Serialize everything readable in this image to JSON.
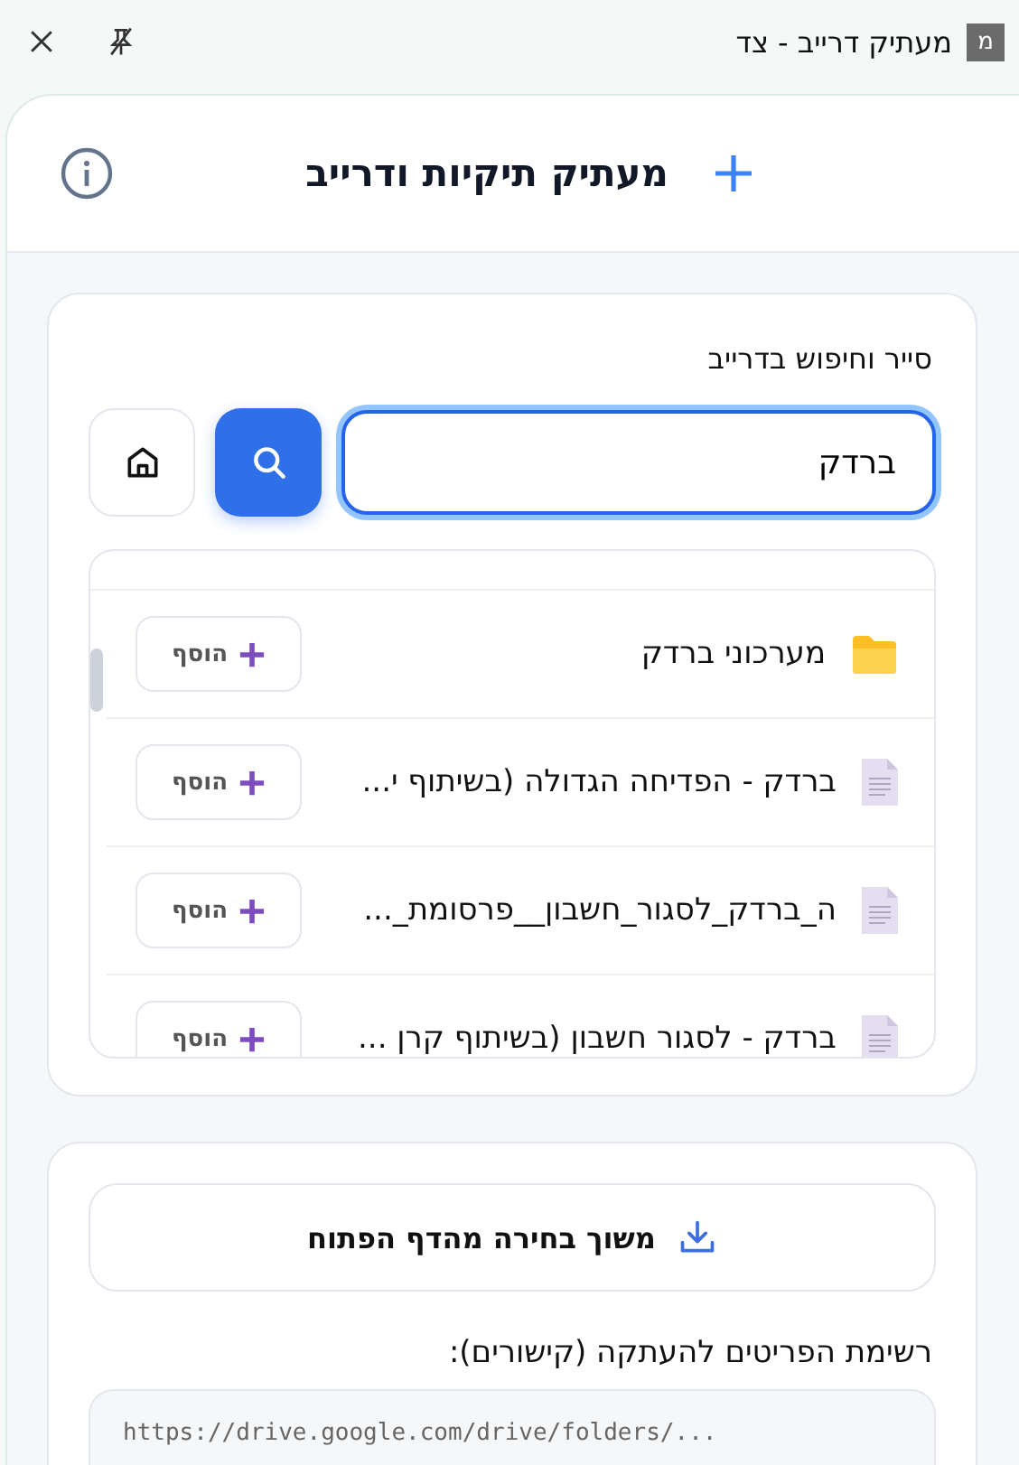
{
  "window": {
    "logo": "מ",
    "title": "מעתיק דרייב - צד"
  },
  "header": {
    "title": "מעתיק תיקיות ודרייב"
  },
  "browser": {
    "label": "סייר וחיפוש בדרייב",
    "search": {
      "value": "ברדק"
    },
    "items": [
      {
        "kind": "folder",
        "name": "מערכוני ברדק",
        "action": "הוסף"
      },
      {
        "kind": "doc",
        "name": "ברדק - הפדיחה הגדולה (בשיתוף י...",
        "action": "הוסף"
      },
      {
        "kind": "doc",
        "name": "ה_ברדק_לסגור_חשבון__פרסומת_...",
        "action": "הוסף"
      },
      {
        "kind": "doc",
        "name": "ברדק - לסגור חשבון (בשיתוף קרן ...",
        "action": "הוסף"
      }
    ]
  },
  "pull_button": "משוך בחירה מהדף הפתוח",
  "links": {
    "label": "רשימת הפריטים להעתקה (קישורים):",
    "placeholder": "https://drive.google.com/drive/folders/..."
  }
}
